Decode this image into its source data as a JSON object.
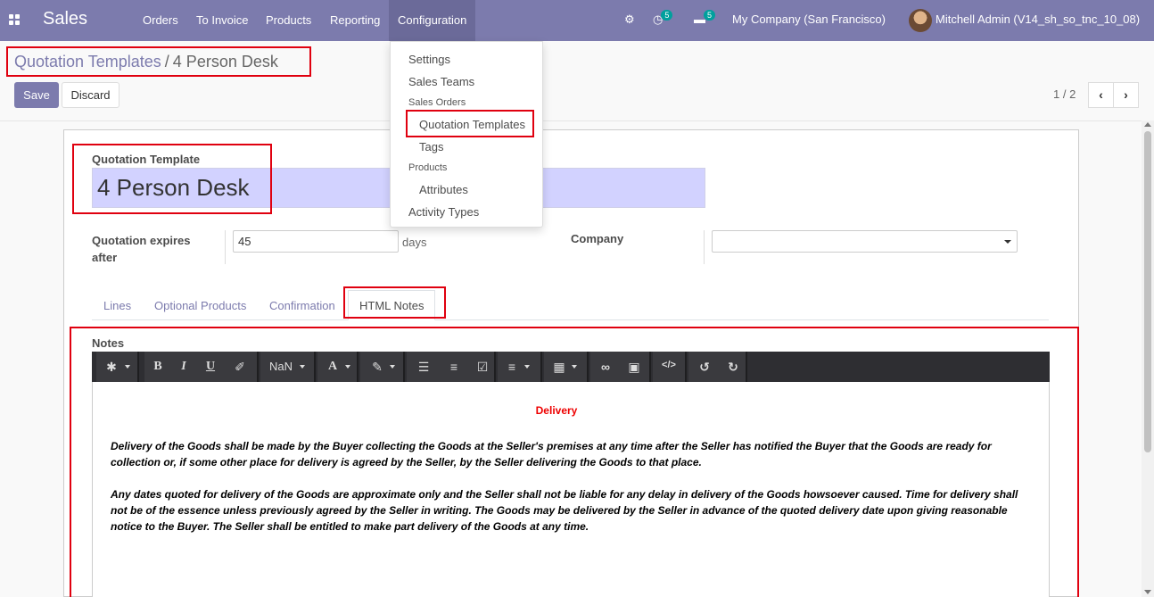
{
  "navbar": {
    "app_name": "Sales",
    "menu": [
      "Orders",
      "To Invoice",
      "Products",
      "Reporting",
      "Configuration"
    ],
    "activity_count": "5",
    "message_count": "5",
    "company": "My Company (San Francisco)",
    "user": "Mitchell Admin (V14_sh_so_tnc_10_08)"
  },
  "breadcrumb": {
    "parent": "Quotation Templates",
    "separator": "/",
    "current": "4 Person Desk"
  },
  "buttons": {
    "save": "Save",
    "discard": "Discard"
  },
  "pager": {
    "text": "1 / 2"
  },
  "form": {
    "template_label": "Quotation Template",
    "template_name": "4 Person Desk",
    "expires_label": "Quotation expires after",
    "expires_value": "45",
    "expires_unit": "days",
    "company_label": "Company",
    "company_value": ""
  },
  "tabs": [
    "Lines",
    "Optional Products",
    "Confirmation",
    "HTML Notes"
  ],
  "notes": {
    "label": "Notes",
    "font_size_value": "NaN",
    "title": "Delivery",
    "paragraphs": [
      "Delivery of the Goods shall be made by the Buyer collecting the Goods at the Seller's premises at any time after the Seller has notified the Buyer that the Goods are ready for collection or, if some other place for delivery is agreed by the Seller, by the Seller delivering the Goods to that place.",
      "Any dates quoted for delivery of the Goods are approximate only and the Seller shall not be liable for any delay in delivery of the Goods howsoever caused. Time for delivery shall not be of the essence unless previously agreed by the Seller in writing. The Goods may be delivered by the Seller in advance of the quoted delivery date upon giving reasonable notice to the Buyer. The Seller shall be entitled to make part delivery of the Goods at any time."
    ]
  },
  "config_menu": {
    "settings": "Settings",
    "sales_teams": "Sales Teams",
    "sales_orders_header": "Sales Orders",
    "quotation_templates": "Quotation Templates",
    "tags": "Tags",
    "products_header": "Products",
    "attributes": "Attributes",
    "activity_types": "Activity Types"
  },
  "colors": {
    "brand": "#7c7bad",
    "highlight": "#e0000f",
    "title_red": "#ee0000",
    "badge": "#00a09d"
  }
}
